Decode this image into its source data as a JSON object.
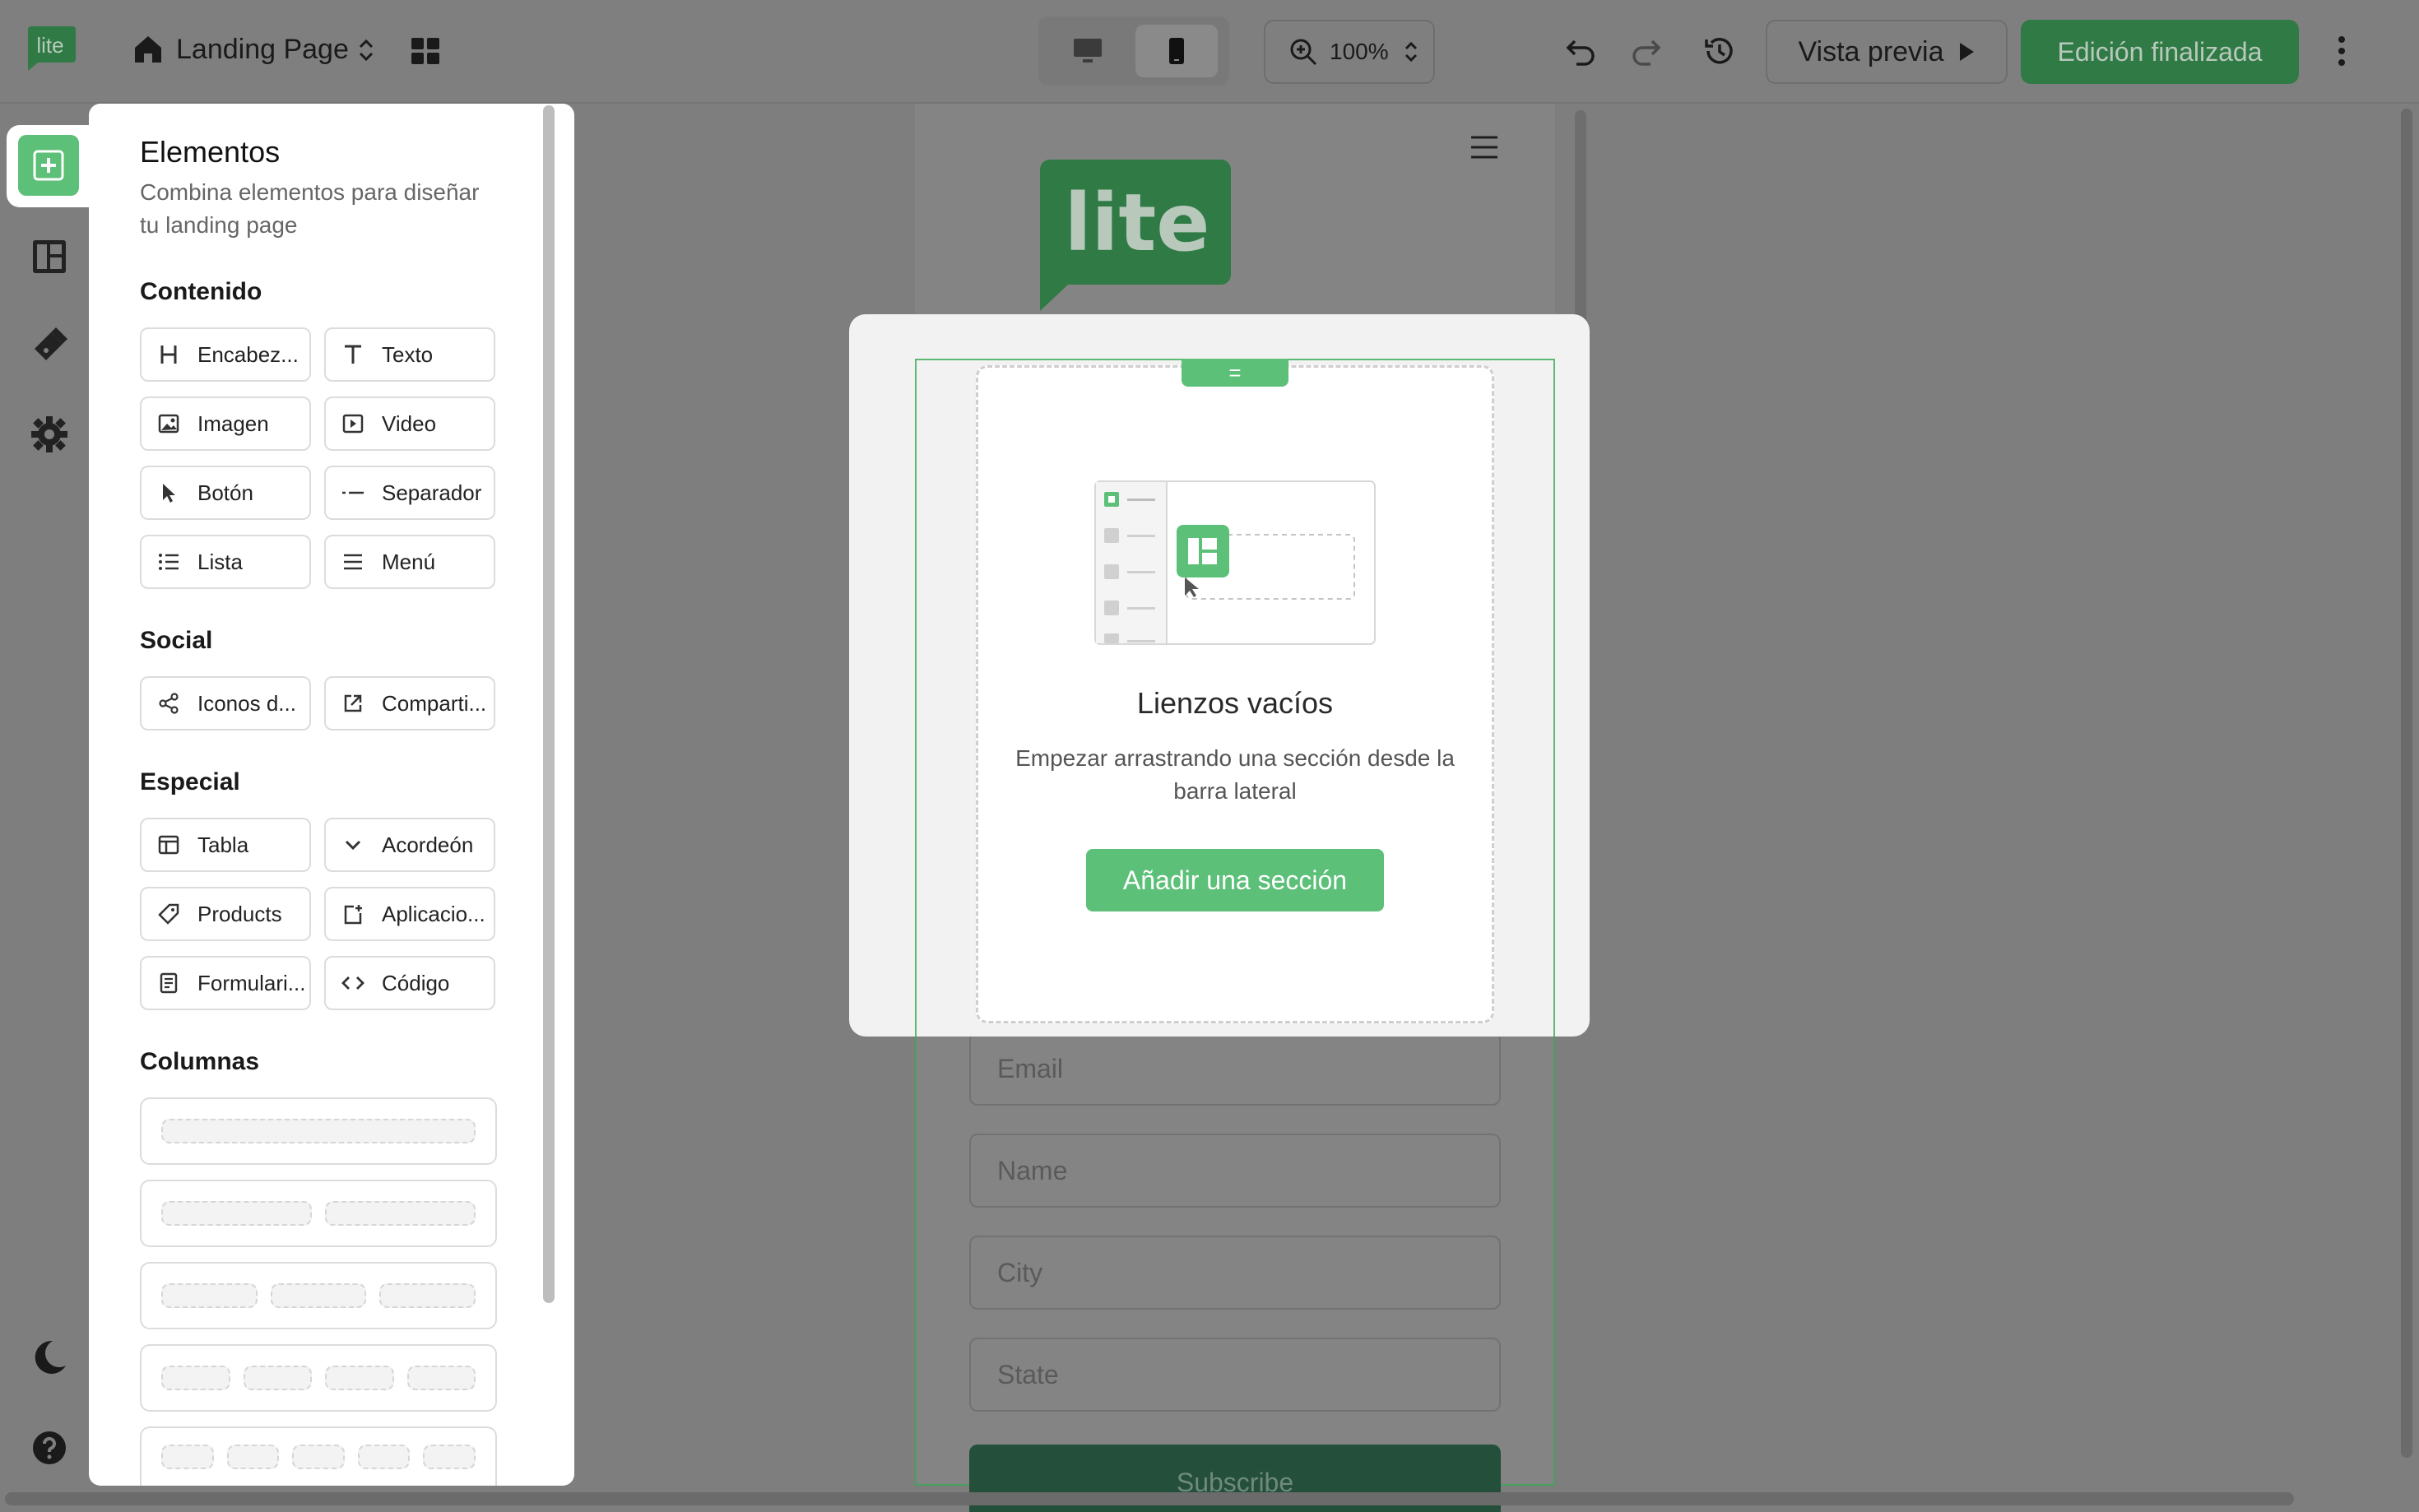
{
  "topbar": {
    "page_name": "Landing Page",
    "zoom": "100%",
    "preview_label": "Vista previa",
    "finish_label": "Edición finalizada"
  },
  "panel": {
    "title": "Elementos",
    "subtitle": "Combina elementos para diseñar tu landing page",
    "sections": {
      "contenido": {
        "title": "Contenido",
        "items": [
          "Encabez...",
          "Texto",
          "Imagen",
          "Video",
          "Botón",
          "Separador",
          "Lista",
          "Menú"
        ]
      },
      "social": {
        "title": "Social",
        "items": [
          "Iconos d...",
          "Comparti..."
        ]
      },
      "especial": {
        "title": "Especial",
        "items": [
          "Tabla",
          "Acordeón",
          "Products",
          "Aplicacio...",
          "Formulari...",
          "Código"
        ]
      },
      "columnas": {
        "title": "Columnas"
      }
    }
  },
  "canvas": {
    "logo_text": "lite",
    "fields": {
      "email": "Email",
      "name": "Name",
      "city": "City",
      "state": "State"
    },
    "subscribe": "Subscribe"
  },
  "modal": {
    "drag_handle": "=",
    "title": "Lienzos vacíos",
    "description": "Empezar arrastrando una sección desde la barra lateral",
    "button": "Añadir una sección"
  },
  "colors": {
    "accent": "#5cc078",
    "accent_dark": "#2f7a45",
    "overlay": "#7f7f7f"
  }
}
